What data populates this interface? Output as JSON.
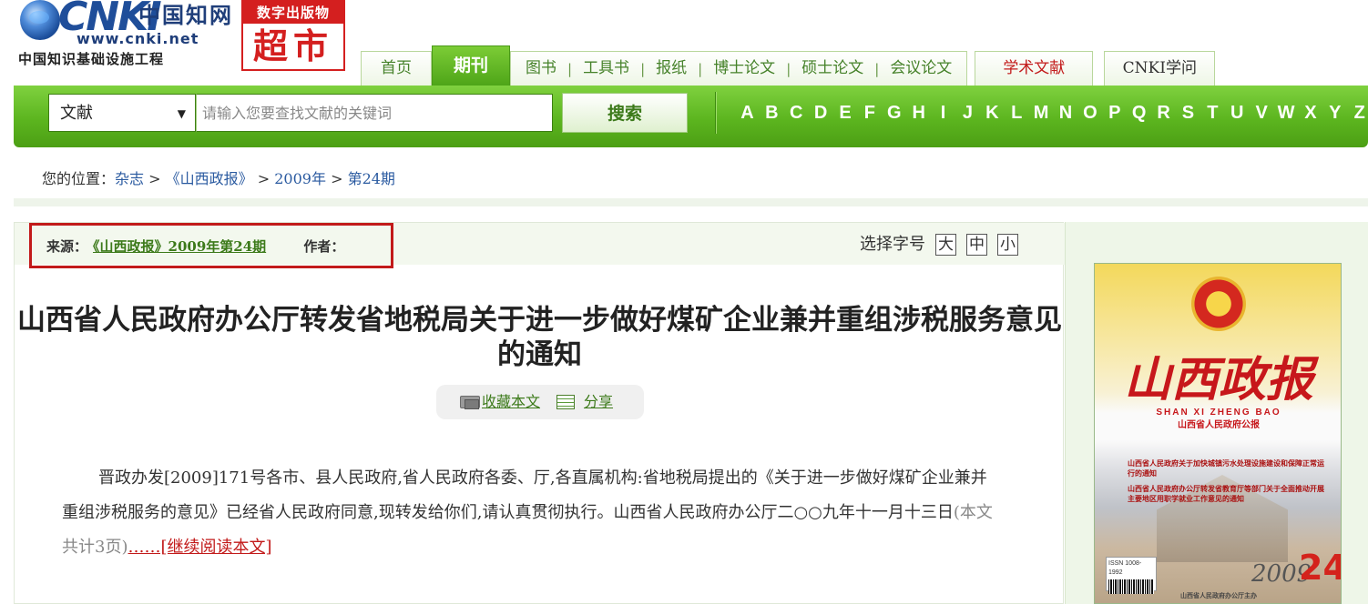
{
  "logo": {
    "brand": "CNKI",
    "brand_cn": "中国知网",
    "url": "www.cnki.net",
    "subtitle": "中国知识基础设施工程"
  },
  "badge": {
    "top": "数字出版物",
    "bottom": "超市"
  },
  "nav": {
    "home": "首页",
    "active": "期刊",
    "items": [
      "图书",
      "工具书",
      "报纸",
      "博士论文",
      "硕士论文",
      "会议论文"
    ],
    "separator": "|",
    "academic": "学术文献",
    "cnki_learn": "CNKI学问"
  },
  "search": {
    "type_value": "文献",
    "placeholder": "请输入您要查找文献的关键词",
    "button": "搜索",
    "letters": [
      "A",
      "B",
      "C",
      "D",
      "E",
      "F",
      "G",
      "H",
      "I",
      "J",
      "K",
      "L",
      "M",
      "N",
      "O",
      "P",
      "Q",
      "R",
      "S",
      "T",
      "U",
      "V",
      "W",
      "X",
      "Y",
      "Z"
    ]
  },
  "breadcrumb": {
    "prefix": "您的位置：",
    "items": [
      "杂志",
      "《山西政报》",
      "2009年",
      "第24期"
    ],
    "separator": ">"
  },
  "article": {
    "source_label": "来源：",
    "source_value": "《山西政报》2009年第24期",
    "author_label": "作者：",
    "fontsize_label": "选择字号",
    "fontsize_options": [
      "大",
      "中",
      "小"
    ],
    "title": "山西省人民政府办公厅转发省地税局关于进一步做好煤矿企业兼并重组涉税服务意见的通知",
    "favorite": "收藏本文",
    "share": "分享",
    "abstract": "晋政办发[2009]171号各市、县人民政府,省人民政府各委、厅,各直属机构:省地税局提出的《关于进一步做好煤矿企业兼并重组涉税服务的意见》已经省人民政府同意,现转发给你们,请认真贯彻执行。山西省人民政府办公厅二○○九年十一月十三日",
    "pages_note": "(本文共计3页)",
    "read_more": "……[继续阅读本文]"
  },
  "cover": {
    "masthead": "山西政报",
    "pinyin": "SHAN XI ZHENG BAO",
    "subtitle": "山西省人民政府公报",
    "toc": [
      "山西省人民政府关于加快城镇污水处理设施建设和保障正常运行的通知",
      "山西省人民政府办公厅转发省教育厅等部门关于全面推动开展主要地区用职学就业工作意见的通知"
    ],
    "issn": "ISSN 1008-1992",
    "year": "2009",
    "issue": "24",
    "publisher": "山西省人民政府办公厅主办"
  },
  "colors": {
    "nav_green": "#5cb51f",
    "link_green": "#3c7a1a",
    "link_blue": "#2a5aa0",
    "highlight_red": "#c21a1a"
  }
}
